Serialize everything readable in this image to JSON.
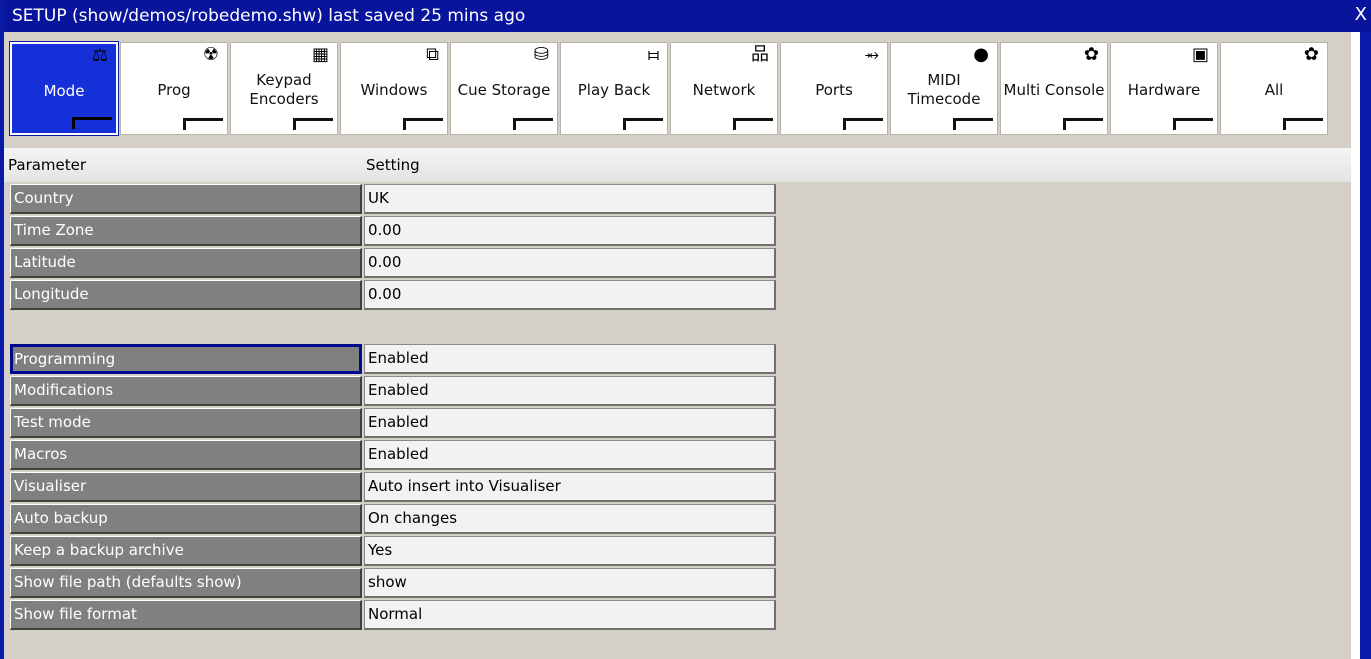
{
  "window": {
    "title": "SETUP (show/demos/robedemo.shw) last saved 25 mins ago",
    "close_label": "X"
  },
  "tabs": [
    {
      "label": "Mode",
      "icon": "mode-icon",
      "glyph": "⚖",
      "active": true
    },
    {
      "label": "Prog",
      "icon": "spotlight-icon",
      "glyph": "☢",
      "active": false
    },
    {
      "label": "Keypad\nEncoders",
      "icon": "keypad-icon",
      "glyph": "▦",
      "active": false
    },
    {
      "label": "Windows",
      "icon": "windows-icon",
      "glyph": "⧉",
      "active": false
    },
    {
      "label": "Cue Storage",
      "icon": "database-icon",
      "glyph": "⛁",
      "active": false
    },
    {
      "label": "Play Back",
      "icon": "faders-icon",
      "glyph": "⧦",
      "active": false
    },
    {
      "label": "Network",
      "icon": "network-icon",
      "glyph": "品",
      "active": false
    },
    {
      "label": "Ports",
      "icon": "usb-icon",
      "glyph": "⥇",
      "active": false
    },
    {
      "label": "MIDI\nTimecode",
      "icon": "midi-icon",
      "glyph": "●",
      "active": false
    },
    {
      "label": "Multi Console",
      "icon": "gear-icon",
      "glyph": "✿",
      "active": false
    },
    {
      "label": "Hardware",
      "icon": "chip-icon",
      "glyph": "▣",
      "active": false
    },
    {
      "label": "All",
      "icon": "gear-icon",
      "glyph": "✿",
      "active": false
    }
  ],
  "table": {
    "header": {
      "parameter": "Parameter",
      "setting": "Setting"
    },
    "group1": [
      {
        "param": "Country",
        "value": "UK"
      },
      {
        "param": "Time Zone",
        "value": "0.00"
      },
      {
        "param": "Latitude",
        "value": "0.00"
      },
      {
        "param": "Longitude",
        "value": "0.00"
      }
    ],
    "group2": [
      {
        "param": "Programming",
        "value": "Enabled"
      },
      {
        "param": "Modifications",
        "value": "Enabled"
      },
      {
        "param": "Test mode",
        "value": "Enabled"
      },
      {
        "param": "Macros",
        "value": "Enabled"
      },
      {
        "param": "Visualiser",
        "value": "Auto insert into Visualiser"
      },
      {
        "param": "Auto backup",
        "value": "On changes"
      },
      {
        "param": "Keep a backup archive",
        "value": "Yes"
      },
      {
        "param": "Show file path (defaults show)",
        "value": "show"
      },
      {
        "param": "Show file format",
        "value": "Normal"
      }
    ]
  }
}
